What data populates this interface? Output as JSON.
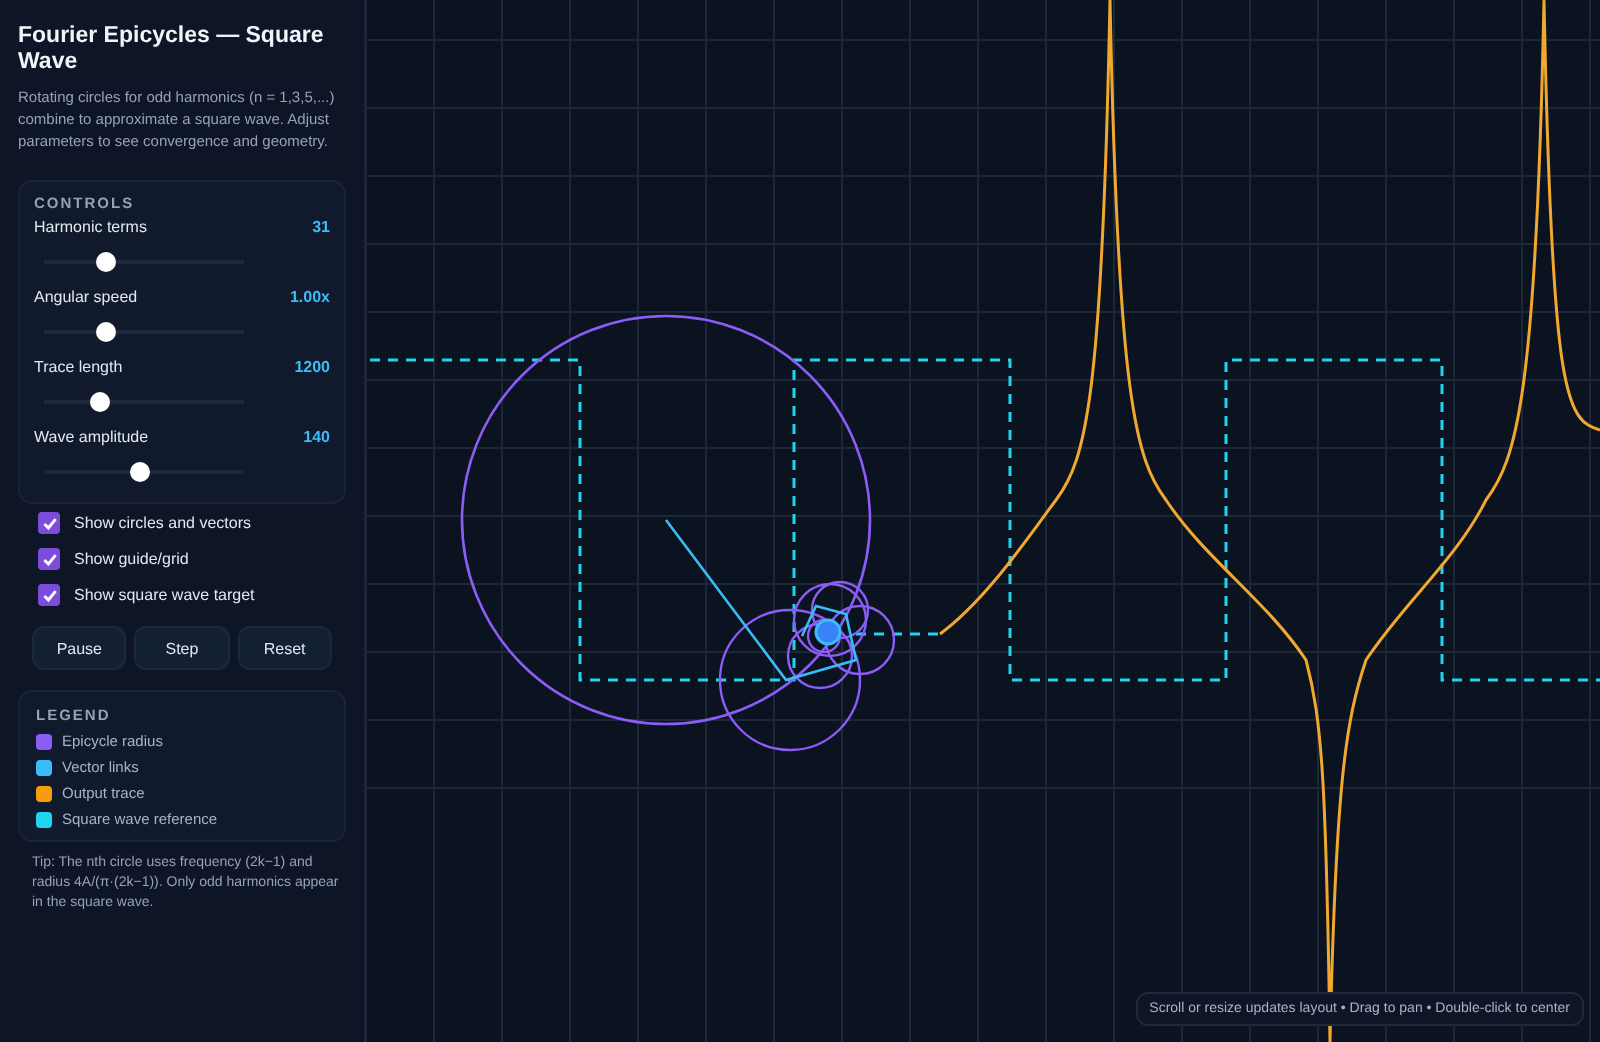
{
  "sidebar": {
    "title": "Fourier Epicycles — Square Wave",
    "description": "Rotating circles for odd harmonics (n = 1,3,5,...) combine to approximate a square wave. Adjust parameters to see convergence and geometry.",
    "controls": {
      "heading": "CONTROLS",
      "sliders": [
        {
          "label": "Harmonic terms",
          "reading": "31",
          "level": 0.31
        },
        {
          "label": "Angular speed",
          "reading": "1.00x",
          "level": 0.31
        },
        {
          "label": "Trace length",
          "reading": "1200",
          "level": 0.28
        },
        {
          "label": "Wave amplitude",
          "reading": "140",
          "level": 0.48
        }
      ],
      "checkboxes": [
        {
          "label": "Show circles and vectors",
          "checked": true
        },
        {
          "label": "Show guide/grid",
          "checked": true
        },
        {
          "label": "Show square wave target",
          "checked": true
        }
      ],
      "buttons": [
        "Pause",
        "Step",
        "Reset"
      ]
    },
    "legend": {
      "heading": "LEGEND",
      "items": [
        {
          "label": "Epicycle radius",
          "color": "#8b5cf6"
        },
        {
          "label": "Vector links",
          "color": "#38bdf8"
        },
        {
          "label": "Output trace",
          "color": "#f59e0b"
        },
        {
          "label": "Square wave reference",
          "color": "#22d3ee"
        }
      ]
    },
    "tip": "Tip: The nth circle uses frequency (2k−1) and radius 4A/(π·(2k−1)). Only odd harmonics appear in the square wave."
  },
  "canvas": {
    "hint": "Scroll or resize updates layout • Drag to pan • Double-click to center"
  }
}
